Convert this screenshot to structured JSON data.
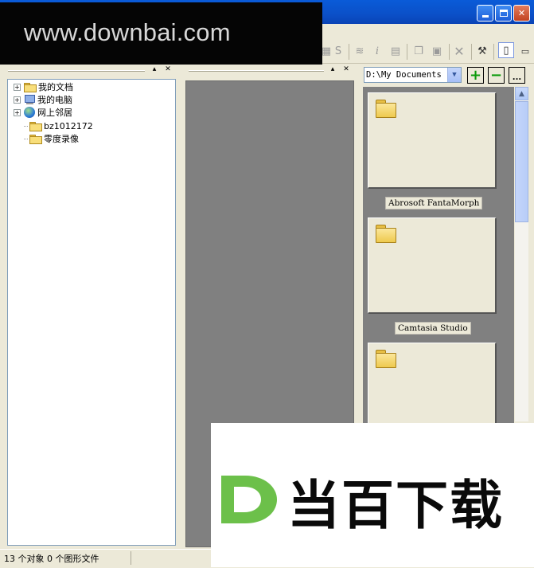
{
  "watermarks": {
    "top_text": "www.downbai.com",
    "bottom_text": "当百下载",
    "logo_letter": "D",
    "logo_color": "#6cc04a"
  },
  "window": {
    "caption_buttons": [
      "minimize",
      "maximize",
      "close"
    ]
  },
  "toolbar": {
    "icons": [
      "stamp-icon",
      "s-icon",
      "stack-icon",
      "info-icon",
      "sheet-icon",
      "copy-icon",
      "paste-icon",
      "delete-icon",
      "tools-icon",
      "view-mode-icon",
      "view-mode-alt-icon"
    ],
    "labels": {
      "s": "S",
      "info": "i"
    }
  },
  "tree": {
    "items": [
      {
        "label": "我的文档",
        "icon": "my-documents-icon",
        "expandable": true
      },
      {
        "label": "我的电脑",
        "icon": "my-computer-icon",
        "expandable": true
      },
      {
        "label": "网上邻居",
        "icon": "network-icon",
        "expandable": true
      },
      {
        "label": "bz1012172",
        "icon": "folder-icon",
        "expandable": false
      },
      {
        "label": "零度录像",
        "icon": "folder-icon",
        "expandable": false
      }
    ]
  },
  "browser": {
    "path_value": "D:\\My Documents",
    "add_label": "+",
    "remove_label": "−",
    "more_label": "..."
  },
  "thumbnails": [
    {
      "caption": "Abrosoft FantaMorph"
    },
    {
      "caption": "Camtasia Studio"
    },
    {
      "caption": ""
    }
  ],
  "status": {
    "text": "13 个对象 0 个图形文件"
  },
  "colors": {
    "titlebar": "#0b50c8",
    "panel_bg": "#ece9d8",
    "thumb_bg": "#808080",
    "accent_green": "#0a9a0a"
  }
}
